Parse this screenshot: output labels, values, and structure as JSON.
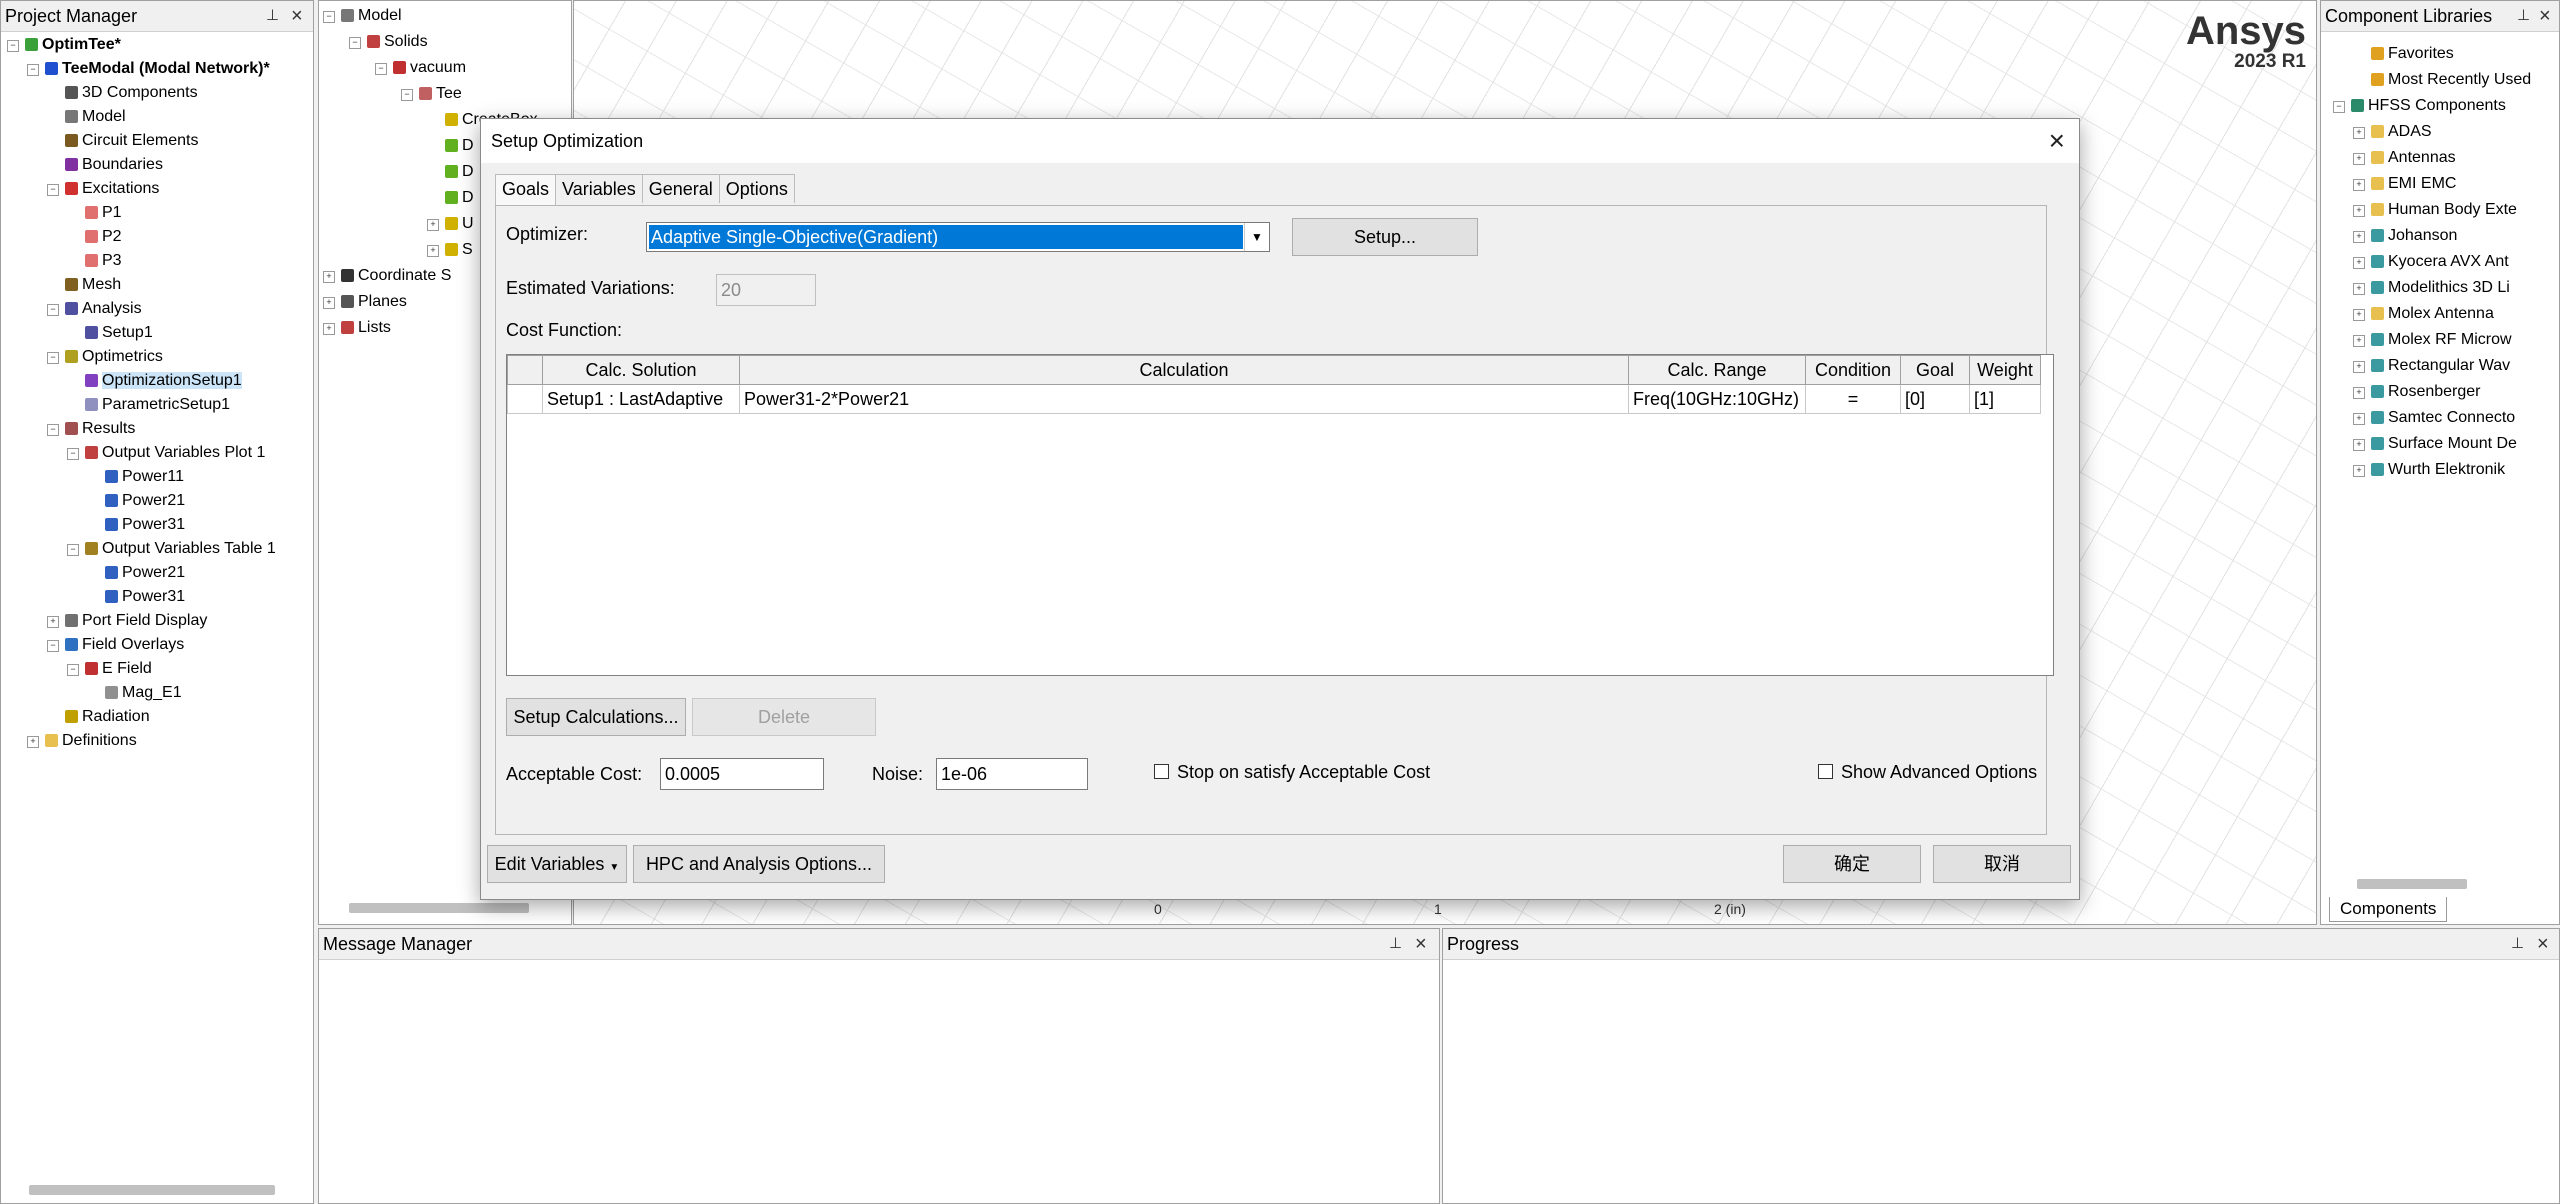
{
  "project_manager": {
    "title": "Project Manager",
    "items": [
      {
        "label": "OptimTee*",
        "level": 0,
        "bold": true,
        "icon": "project-icon",
        "color": "#3aa03a",
        "toggle": "−"
      },
      {
        "label": "TeeModal (Modal Network)*",
        "level": 1,
        "bold": true,
        "icon": "design-icon",
        "color": "#2050d0",
        "toggle": "−"
      },
      {
        "label": "3D Components",
        "level": 2,
        "icon": "components-icon",
        "color": "#555555"
      },
      {
        "label": "Model",
        "level": 2,
        "icon": "model-icon",
        "color": "#777777"
      },
      {
        "label": "Circuit Elements",
        "level": 2,
        "icon": "circuit-icon",
        "color": "#7a5a20"
      },
      {
        "label": "Boundaries",
        "level": 2,
        "icon": "boundaries-icon",
        "color": "#8030a0"
      },
      {
        "label": "Excitations",
        "level": 2,
        "icon": "excitations-icon",
        "color": "#d03030",
        "toggle": "−"
      },
      {
        "label": "P1",
        "level": 3,
        "icon": "port-icon",
        "color": "#e07070"
      },
      {
        "label": "P2",
        "level": 3,
        "icon": "port-icon",
        "color": "#e07070"
      },
      {
        "label": "P3",
        "level": 3,
        "icon": "port-icon",
        "color": "#e07070"
      },
      {
        "label": "Mesh",
        "level": 2,
        "icon": "mesh-icon",
        "color": "#806020"
      },
      {
        "label": "Analysis",
        "level": 2,
        "icon": "analysis-icon",
        "color": "#5050a0",
        "toggle": "−"
      },
      {
        "label": "Setup1",
        "level": 3,
        "icon": "setup-icon",
        "color": "#5050a0"
      },
      {
        "label": "Optimetrics",
        "level": 2,
        "icon": "optimetrics-icon",
        "color": "#b0a020",
        "toggle": "−"
      },
      {
        "label": "OptimizationSetup1",
        "level": 3,
        "icon": "optimization-icon",
        "color": "#8040c0",
        "selected": true
      },
      {
        "label": "ParametricSetup1",
        "level": 3,
        "icon": "parametric-icon",
        "color": "#9090c0"
      },
      {
        "label": "Results",
        "level": 2,
        "icon": "results-icon",
        "color": "#a05050",
        "toggle": "−"
      },
      {
        "label": "Output Variables Plot 1",
        "level": 3,
        "icon": "plot-icon",
        "color": "#c04040",
        "toggle": "−"
      },
      {
        "label": "Power11",
        "level": 4,
        "icon": "trace-icon",
        "color": "#3060c0"
      },
      {
        "label": "Power21",
        "level": 4,
        "icon": "trace-icon",
        "color": "#3060c0"
      },
      {
        "label": "Power31",
        "level": 4,
        "icon": "trace-icon",
        "color": "#3060c0"
      },
      {
        "label": "Output Variables Table 1",
        "level": 3,
        "icon": "table-icon",
        "color": "#a08020",
        "toggle": "−"
      },
      {
        "label": "Power21",
        "level": 4,
        "icon": "trace-icon",
        "color": "#3060c0"
      },
      {
        "label": "Power31",
        "level": 4,
        "icon": "trace-icon",
        "color": "#3060c0"
      },
      {
        "label": "Port Field Display",
        "level": 2,
        "icon": "port-field-icon",
        "color": "#707070",
        "toggle": "+"
      },
      {
        "label": "Field Overlays",
        "level": 2,
        "icon": "field-overlays-icon",
        "color": "#3070c0",
        "toggle": "−"
      },
      {
        "label": "E Field",
        "level": 3,
        "icon": "efield-icon",
        "color": "#c03030",
        "toggle": "−"
      },
      {
        "label": "Mag_E1",
        "level": 4,
        "icon": "mag-icon",
        "color": "#909090"
      },
      {
        "label": "Radiation",
        "level": 2,
        "icon": "radiation-icon",
        "color": "#c0a000"
      },
      {
        "label": "Definitions",
        "level": 1,
        "icon": "folder-icon",
        "color": "#e8c050",
        "toggle": "+"
      }
    ]
  },
  "model_tree": {
    "items": [
      {
        "label": "Model",
        "level": 0,
        "toggle": "−",
        "icon": "model-icon",
        "color": "#777777"
      },
      {
        "label": "Solids",
        "level": 1,
        "toggle": "−",
        "icon": "solids-icon",
        "color": "#c04040"
      },
      {
        "label": "vacuum",
        "level": 2,
        "toggle": "−",
        "icon": "material-icon",
        "color": "#c03030"
      },
      {
        "label": "Tee",
        "level": 3,
        "toggle": "−",
        "icon": "object-icon",
        "color": "#c06060"
      },
      {
        "label": "CreateBox",
        "level": 4,
        "icon": "createbox-icon",
        "color": "#d0b000"
      },
      {
        "label": "D",
        "level": 4,
        "icon": "op-icon",
        "color": "#60b020"
      },
      {
        "label": "D",
        "level": 4,
        "icon": "op-icon",
        "color": "#60b020"
      },
      {
        "label": "D",
        "level": 4,
        "icon": "op-icon",
        "color": "#60b020"
      },
      {
        "label": "U",
        "level": 4,
        "toggle": "+",
        "icon": "op-icon",
        "color": "#d0b000"
      },
      {
        "label": "S",
        "level": 4,
        "toggle": "+",
        "icon": "op-icon",
        "color": "#d0b000"
      },
      {
        "label": "Coordinate S",
        "level": 0,
        "toggle": "+",
        "icon": "cs-icon",
        "color": "#333333"
      },
      {
        "label": "Planes",
        "level": 0,
        "toggle": "+",
        "icon": "planes-icon",
        "color": "#555555"
      },
      {
        "label": "Lists",
        "level": 0,
        "toggle": "+",
        "icon": "lists-icon",
        "color": "#c04040"
      }
    ]
  },
  "viewport": {
    "brand": "Ansys",
    "version": "2023 R1",
    "ruler": [
      "0",
      "1",
      "2 (in)"
    ]
  },
  "component_libraries": {
    "title": "Component Libraries",
    "items": [
      {
        "label": "Favorites",
        "level": 1,
        "icon": "favorites-icon",
        "color": "#e0a020"
      },
      {
        "label": "Most Recently Used",
        "level": 1,
        "icon": "recent-icon",
        "color": "#e0a020"
      },
      {
        "label": "HFSS Components",
        "level": 0,
        "toggle": "−",
        "icon": "hfss-icon",
        "color": "#2a8a6a"
      },
      {
        "label": "ADAS",
        "level": 1,
        "toggle": "+",
        "icon": "folder-icon",
        "color": "#e8c050"
      },
      {
        "label": "Antennas",
        "level": 1,
        "toggle": "+",
        "icon": "folder-icon",
        "color": "#e8c050"
      },
      {
        "label": "EMI EMC",
        "level": 1,
        "toggle": "+",
        "icon": "folder-icon",
        "color": "#e8c050"
      },
      {
        "label": "Human Body Exte",
        "level": 1,
        "toggle": "+",
        "icon": "folder-icon",
        "color": "#e8c050"
      },
      {
        "label": "Johanson",
        "level": 1,
        "toggle": "+",
        "icon": "vendor-icon",
        "color": "#3a9aa0"
      },
      {
        "label": "Kyocera AVX Ant",
        "level": 1,
        "toggle": "+",
        "icon": "vendor-icon",
        "color": "#3a9aa0"
      },
      {
        "label": "Modelithics 3D Li",
        "level": 1,
        "toggle": "+",
        "icon": "vendor-icon",
        "color": "#3a9aa0"
      },
      {
        "label": "Molex Antenna",
        "level": 1,
        "toggle": "+",
        "icon": "folder-icon",
        "color": "#e8c050"
      },
      {
        "label": "Molex RF Microw",
        "level": 1,
        "toggle": "+",
        "icon": "vendor-icon",
        "color": "#3a9aa0"
      },
      {
        "label": "Rectangular Wav",
        "level": 1,
        "toggle": "+",
        "icon": "vendor-icon",
        "color": "#3a9aa0"
      },
      {
        "label": "Rosenberger",
        "level": 1,
        "toggle": "+",
        "icon": "vendor-icon",
        "color": "#3a9aa0"
      },
      {
        "label": "Samtec Connecto",
        "level": 1,
        "toggle": "+",
        "icon": "vendor-icon",
        "color": "#3a9aa0"
      },
      {
        "label": "Surface Mount De",
        "level": 1,
        "toggle": "+",
        "icon": "vendor-icon",
        "color": "#3a9aa0"
      },
      {
        "label": "Wurth Elektronik",
        "level": 1,
        "toggle": "+",
        "icon": "vendor-icon",
        "color": "#3a9aa0"
      }
    ],
    "tab": "Components"
  },
  "message_manager": {
    "title": "Message Manager"
  },
  "progress": {
    "title": "Progress"
  },
  "dialog": {
    "title": "Setup Optimization",
    "tabs": [
      "Goals",
      "Variables",
      "General",
      "Options"
    ],
    "optimizer_label": "Optimizer:",
    "optimizer_value": "Adaptive Single-Objective(Gradient)",
    "setup_button": "Setup...",
    "estimated_label": "Estimated Variations:",
    "estimated_value": "20",
    "cost_function_label": "Cost Function:",
    "table": {
      "headers": [
        "",
        "Calc. Solution",
        "Calculation",
        "Calc. Range",
        "Condition",
        "Goal",
        "Weight"
      ],
      "rows": [
        [
          "",
          "Setup1 : LastAdaptive",
          "Power31-2*Power21",
          "Freq(10GHz:10GHz)",
          "=",
          "[0]",
          "[1]"
        ]
      ]
    },
    "setup_calculations_button": "Setup Calculations...",
    "delete_button": "Delete",
    "acceptable_cost_label": "Acceptable Cost:",
    "acceptable_cost_value": "0.0005",
    "noise_label": "Noise:",
    "noise_value": "1e-06",
    "stop_on_satisfy_label": "Stop on satisfy Acceptable Cost",
    "show_advanced_label": "Show Advanced Options",
    "edit_variables_button": "Edit Variables",
    "hpc_button": "HPC and Analysis Options...",
    "ok_button": "确定",
    "cancel_button": "取消"
  }
}
